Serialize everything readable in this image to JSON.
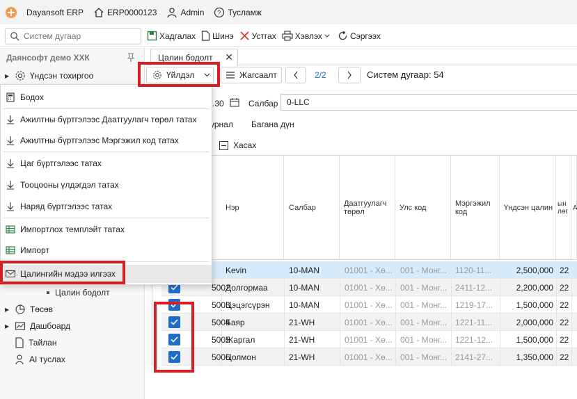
{
  "titlebar": {
    "app_name": "Dayansoft ERP",
    "company_code": "ERP0000123",
    "user": "Admin",
    "help": "Тусламж"
  },
  "toolbar": {
    "search_placeholder": "Систем дугаар",
    "save": "Хадгалах",
    "new": "Шинэ",
    "delete": "Устгах",
    "print": "Хэвлэх",
    "refresh": "Сэргээх"
  },
  "sidebar": {
    "company": "Даянсофт демо ХХК",
    "settings": "Үндсэн тохиргоо",
    "sub_item": "Цалин бодолт",
    "items": [
      "Төсөв",
      "Дашбоард",
      "Тайлан",
      "AI туслах"
    ]
  },
  "dropdown": {
    "items": [
      "Бодох",
      "Ажилтны бүртгэлээс Даатгуулагч төрөл татах",
      "Ажилтны бүртгэлээс Мэргэжил код татах",
      "Цаг бүртгэлээс татах",
      "Тооцооны үлдэгдэл татах",
      "Наряд бүртгэлээс татах",
      "Импортлох темплэйт татах",
      "Импорт",
      "Цалингийн мэдээ илгээх"
    ]
  },
  "tab": {
    "label": "Цалин бодолт"
  },
  "actions": {
    "action_menu": "Үйлдэл",
    "journal": "Жагсаалт",
    "pager": "2/2",
    "system_number": "Систем дугаар: 54"
  },
  "filters": {
    "date_suffix": ".30",
    "branch_label": "Салбар",
    "branch_value": "0-LLC",
    "journal_tab": "урнал",
    "column_total": "Багана дүн",
    "remove_button": "Хасах"
  },
  "table": {
    "headers": [
      "Нэр",
      "Салбар",
      "Даатгуулагч төрөл",
      "Улс код",
      "Мэргэжил код",
      "Үндсэн цалин",
      "ын\nлөг",
      "А"
    ],
    "rows": [
      {
        "code": "",
        "name": "Kevin",
        "branch": "10-MAN",
        "ins": "01001 - Хө...",
        "country": "001 - Монг...",
        "prof": "1120-11...",
        "salary": "2,500,000",
        "d": "22",
        "checked": false
      },
      {
        "code": "5002",
        "name": "Долгормаа",
        "branch": "10-MAN",
        "ins": "01001 - Хө...",
        "country": "001 - Монг...",
        "prof": "2411-12...",
        "salary": "2,200,000",
        "d": "22",
        "checked": true
      },
      {
        "code": "5003",
        "name": "Цэцэгсүрэн",
        "branch": "10-MAN",
        "ins": "01001 - Хө...",
        "country": "001 - Монг...",
        "prof": "1219-17...",
        "salary": "1,500,000",
        "d": "22",
        "checked": true
      },
      {
        "code": "5004",
        "name": "Баяр",
        "branch": "21-WH",
        "ins": "01001 - Хө...",
        "country": "001 - Монг...",
        "prof": "1221-11...",
        "salary": "2,000,000",
        "d": "22",
        "checked": true
      },
      {
        "code": "5005",
        "name": "Жаргал",
        "branch": "21-WH",
        "ins": "01001 - Хө...",
        "country": "001 - Монг...",
        "prof": "1221-12...",
        "salary": "1,500,000",
        "d": "22",
        "checked": true
      },
      {
        "code": "5006",
        "name": "Цолмон",
        "branch": "21-WH",
        "ins": "01001 - Хө...",
        "country": "001 - Монг...",
        "prof": "2141-27...",
        "salary": "1,350,000",
        "d": "22",
        "checked": true
      }
    ]
  },
  "colors": {
    "accent": "#1e6ec8",
    "highlight": "#d61f26",
    "selected_row": "#d6ebfb"
  }
}
